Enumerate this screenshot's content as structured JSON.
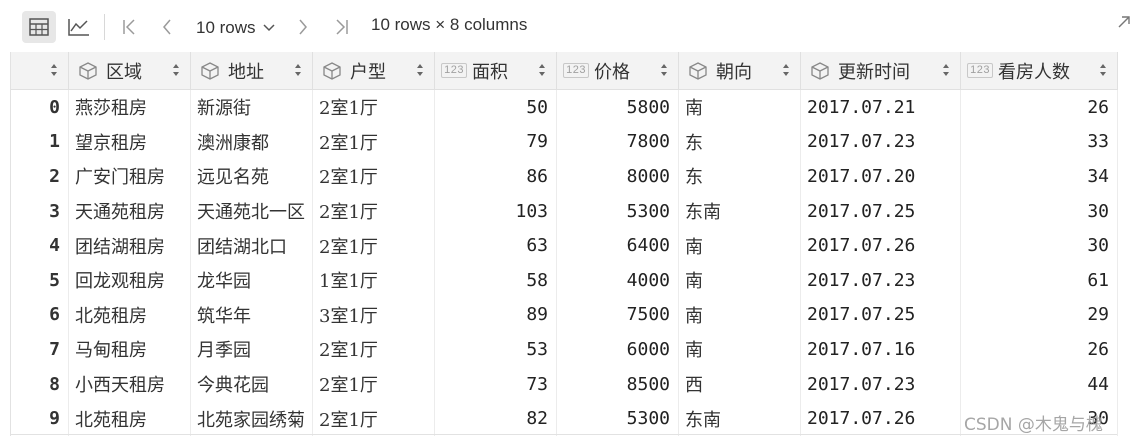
{
  "toolbar": {
    "table_view_icon": "table-icon",
    "chart_view_icon": "line-chart-icon",
    "first_icon": "first-page-icon",
    "prev_icon": "prev-page-icon",
    "next_icon": "next-page-icon",
    "last_icon": "last-page-icon",
    "rows_select": "10 rows",
    "summary": "10 rows × 8 columns"
  },
  "columns": [
    {
      "label": "",
      "type": "index"
    },
    {
      "label": "区域",
      "type": "object"
    },
    {
      "label": "地址",
      "type": "object"
    },
    {
      "label": "户型",
      "type": "object"
    },
    {
      "label": "面积",
      "type": "number"
    },
    {
      "label": "价格",
      "type": "number"
    },
    {
      "label": "朝向",
      "type": "object"
    },
    {
      "label": "更新时间",
      "type": "object"
    },
    {
      "label": "看房人数",
      "type": "number"
    }
  ],
  "type_badge": "123",
  "rows": [
    [
      "0",
      "燕莎租房",
      "新源街",
      "2室1厅",
      "50",
      "5800",
      "南",
      "2017.07.21",
      "26"
    ],
    [
      "1",
      "望京租房",
      "澳洲康都",
      "2室1厅",
      "79",
      "7800",
      "东",
      "2017.07.23",
      "33"
    ],
    [
      "2",
      "广安门租房",
      "远见名苑",
      "2室1厅",
      "86",
      "8000",
      "东",
      "2017.07.20",
      "34"
    ],
    [
      "3",
      "天通苑租房",
      "天通苑北一区",
      "2室1厅",
      "103",
      "5300",
      "东南",
      "2017.07.25",
      "30"
    ],
    [
      "4",
      "团结湖租房",
      "团结湖北口",
      "2室1厅",
      "63",
      "6400",
      "南",
      "2017.07.26",
      "30"
    ],
    [
      "5",
      "回龙观租房",
      "龙华园",
      "1室1厅",
      "58",
      "4000",
      "南",
      "2017.07.23",
      "61"
    ],
    [
      "6",
      "北苑租房",
      "筑华年",
      "3室1厅",
      "89",
      "7500",
      "南",
      "2017.07.25",
      "29"
    ],
    [
      "7",
      "马甸租房",
      "月季园",
      "2室1厅",
      "53",
      "6000",
      "南",
      "2017.07.16",
      "26"
    ],
    [
      "8",
      "小西天租房",
      "今典花园",
      "2室1厅",
      "73",
      "8500",
      "西",
      "2017.07.23",
      "44"
    ],
    [
      "9",
      "北苑租房",
      "北苑家园绣菊",
      "2室1厅",
      "82",
      "5300",
      "东南",
      "2017.07.26",
      "30"
    ]
  ],
  "watermark": "CSDN @木鬼与槐"
}
